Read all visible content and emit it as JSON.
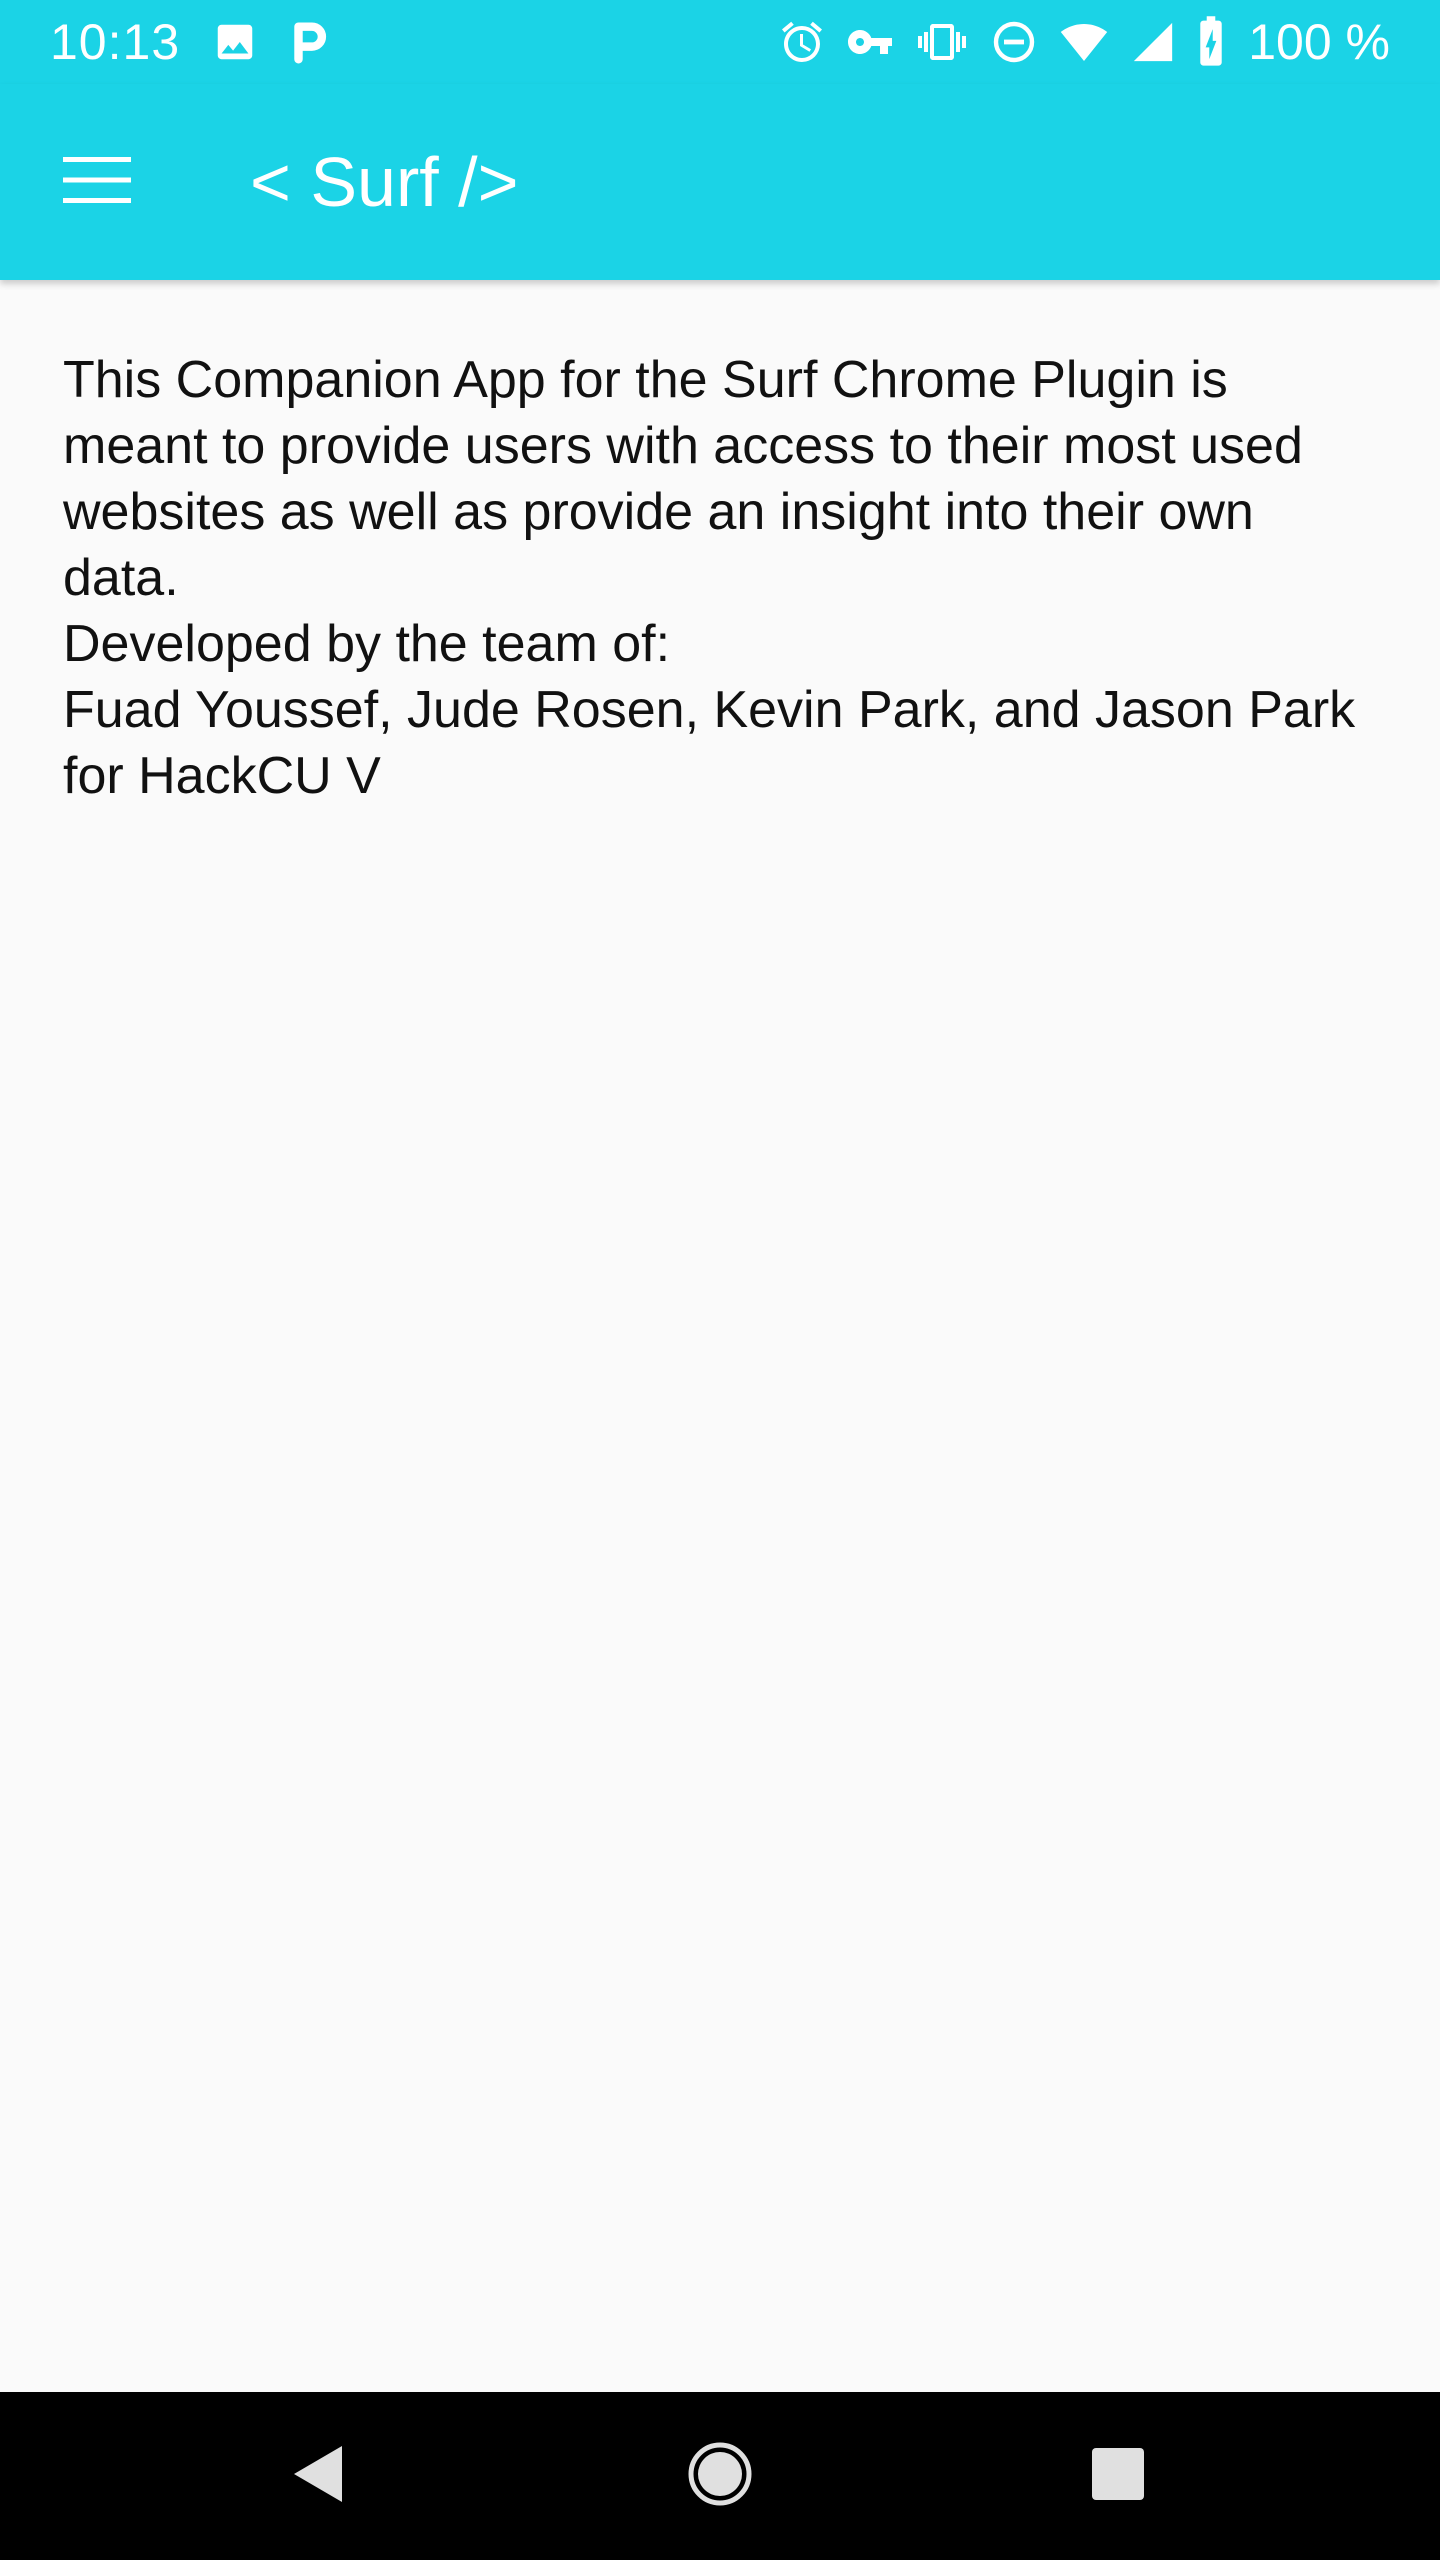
{
  "status_bar": {
    "time": "10:13",
    "battery_text": "100 %",
    "icons": [
      "image-icon",
      "p-app-icon",
      "alarm-icon",
      "vpn-key-icon",
      "vibrate-icon",
      "do-not-disturb-icon",
      "wifi-icon",
      "signal-icon",
      "battery-charging-icon"
    ]
  },
  "app_bar": {
    "title": "< Surf />",
    "menu_icon": "menu-icon"
  },
  "content": {
    "description": "This Companion App for the Surf Chrome Plugin is meant to provide users with access to their most used websites as well as provide an insight into their own data.",
    "team_heading": "Developed by the team of:",
    "team_members": "Fuad Youssef, Jude Rosen, Kevin Park, and Jason Park for HackCU V"
  },
  "nav_bar": {
    "icons": [
      "back-icon",
      "home-icon",
      "recents-icon"
    ]
  },
  "colors": {
    "accent": "#1BD3E6",
    "background": "#FAFAFA",
    "text": "#111111",
    "nav_bar": "#000000"
  }
}
